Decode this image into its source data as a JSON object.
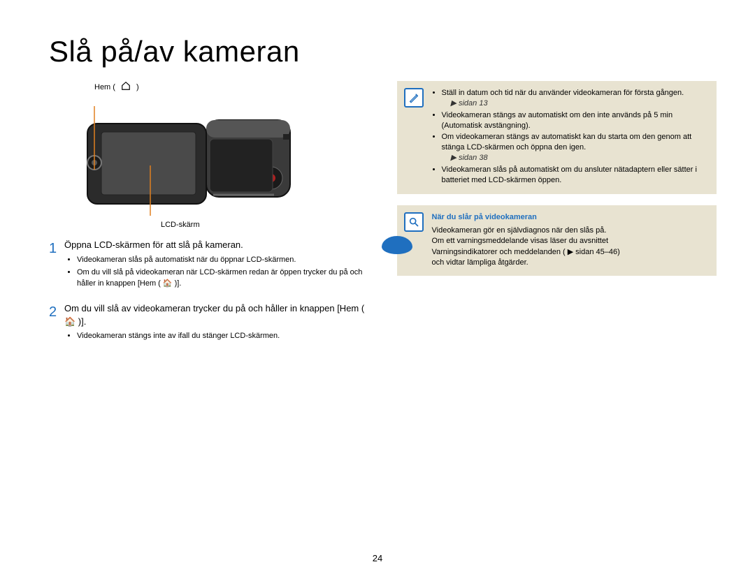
{
  "title": "Slå på/av kameran",
  "labels": {
    "top_left": "Hem (",
    "top_right": ")",
    "lcd": "LCD-skärm"
  },
  "steps": [
    {
      "num": "1",
      "text": "Öppna LCD-skärmen för att slå på kameran.",
      "bullets": [
        "Videokameran slås på automatiskt när du öppnar LCD-skärmen.",
        "Om du vill slå på videokameran när LCD-skärmen redan är öppen trycker du på och håller in knappen [Hem ( 🏠 )]."
      ]
    },
    {
      "num": "2",
      "text": "Om du vill slå av videokameran trycker du på och håller in knappen [Hem ( 🏠 )].",
      "bullets": [
        "Videokameran stängs inte av ifall du stänger LCD-skärmen."
      ]
    }
  ],
  "note": {
    "items": [
      {
        "text": "Ställ in datum och tid när du använder videokameran för första gången.",
        "ref": "sidan 13"
      },
      {
        "text": "5 min",
        "prefix": "Videokameran stängs av automatiskt om den inte används på ",
        "suffix": " (Automatisk avstängning)."
      },
      {
        "text": "Om videokameran stängs av automatiskt kan du starta om den genom att stänga LCD-skärmen och öppna den igen.",
        "ref": "sidan 38"
      },
      {
        "text": "Videokameran slås på automatiskt om du ansluter nätadaptern eller sätter i batteriet med LCD-skärmen öppen."
      }
    ]
  },
  "info": {
    "heading": "När du slår på videokameran",
    "lines": [
      "Videokameran gör en självdiagnos när den slås på.",
      "Om ett varningsmeddelande visas läser du avsnittet",
      "Varningsindikatorer och meddelanden (",
      "och vidtar lämpliga åtgärder.",
      ""
    ],
    "ref": "sidan 45–46)"
  },
  "page_number": "24"
}
